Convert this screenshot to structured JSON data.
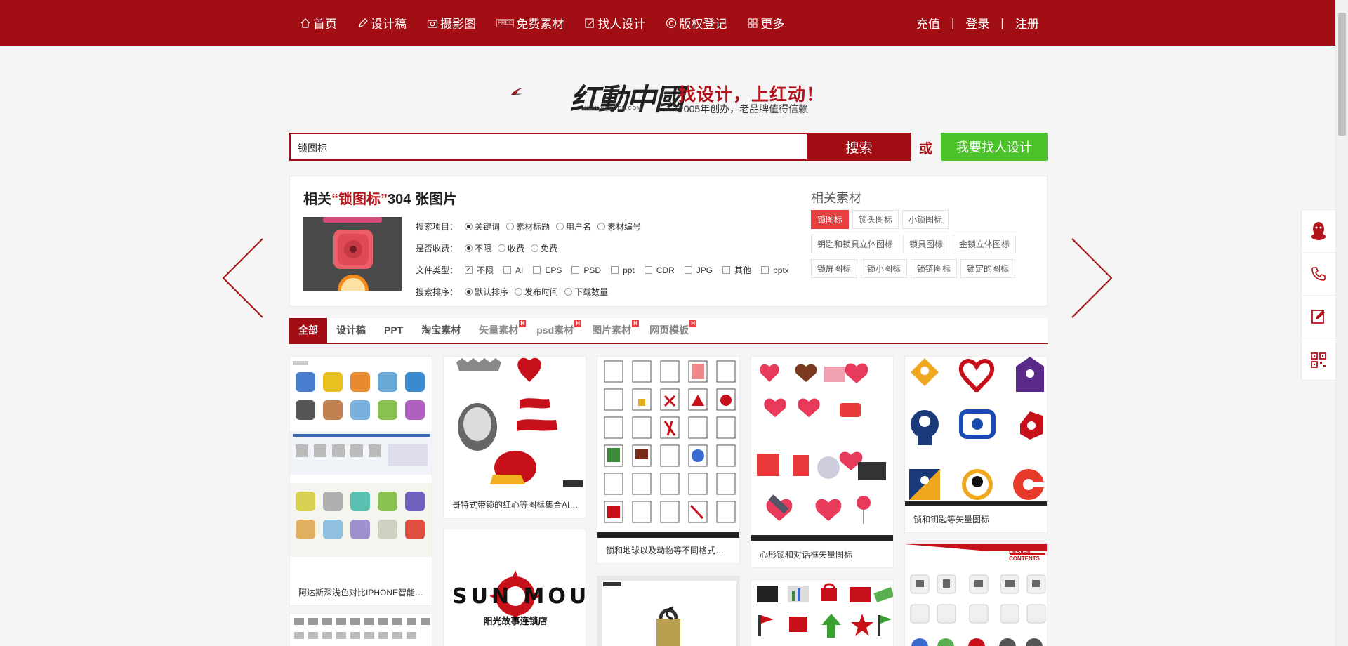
{
  "nav": {
    "items": [
      {
        "label": "首页",
        "icon": "home-icon"
      },
      {
        "label": "设计稿",
        "icon": "pen-icon"
      },
      {
        "label": "摄影图",
        "icon": "camera-icon"
      },
      {
        "label": "免费素材",
        "icon": "free-icon",
        "tag": "FREE"
      },
      {
        "label": "找人设计",
        "icon": "edit-icon"
      },
      {
        "label": "版权登记",
        "icon": "copyright-icon"
      },
      {
        "label": "更多",
        "icon": "grid-icon"
      }
    ],
    "recharge": "充值",
    "login": "登录",
    "register": "注册",
    "separator": "|"
  },
  "logo": {
    "cn_text": "红動中國",
    "url_text": "WWW.REDOCN.COM",
    "slogan_main": "找设计，上红动！",
    "slogan_sub": "2005年创办，老品牌值得信赖"
  },
  "search": {
    "value": "锁图标",
    "button": "搜索",
    "or": "或",
    "find_designer": "我要找人设计"
  },
  "results": {
    "prefix": "相关",
    "keyword": "“锁图标”",
    "count_text": "304 张图片"
  },
  "filters": {
    "search_scope": {
      "label": "搜索项目：",
      "options": [
        "关键词",
        "素材标题",
        "用户名",
        "素材编号"
      ],
      "selected": 0
    },
    "charge": {
      "label": "是否收费：",
      "options": [
        "不限",
        "收费",
        "免费"
      ],
      "selected": 0
    },
    "file_type": {
      "label": "文件类型：",
      "options": [
        "不限",
        "AI",
        "EPS",
        "PSD",
        "ppt",
        "CDR",
        "JPG",
        "其他",
        "pptx"
      ],
      "selected": 0
    },
    "sort": {
      "label": "搜索排序：",
      "options": [
        "默认排序",
        "发布时间",
        "下载数量"
      ],
      "selected": 0
    }
  },
  "related": {
    "title": "相关素材",
    "tags": [
      "锁图标",
      "锁头图标",
      "小锁图标",
      "钥匙和锁具立体图标",
      "锁具图标",
      "金锁立体图标",
      "锁屏图标",
      "锁小图标",
      "锁链图标",
      "锁定的图标"
    ],
    "active": 0
  },
  "tabs": [
    {
      "label": "全部",
      "active": true,
      "hot": false
    },
    {
      "label": "设计稿",
      "active": false,
      "hot": false
    },
    {
      "label": "PPT",
      "active": false,
      "hot": false
    },
    {
      "label": "淘宝素材",
      "active": false,
      "hot": false
    },
    {
      "label": "矢量素材",
      "active": false,
      "hot": true
    },
    {
      "label": "psd素材",
      "active": false,
      "hot": true
    },
    {
      "label": "图片素材",
      "active": false,
      "hot": true
    },
    {
      "label": "网页模板",
      "active": false,
      "hot": true
    }
  ],
  "hot_badge": "H",
  "cards": [
    {
      "caption": "阿达斯深浅色对比IPHONE智能手机图标"
    },
    {
      "caption": "哥特式带锁的红心等图标集合AI矢量素材"
    },
    {
      "caption": "锁和地球以及动物等不同格式文件图标"
    },
    {
      "caption": "心形锁和对话框矢量图标"
    },
    {
      "caption": "锁和钥匙等矢量图标"
    },
    {
      "caption": "SUN MOUNT",
      "sub": "阳光故事连锁店"
    },
    {
      "caption": "DESIGN CONTENTS"
    }
  ],
  "colors": {
    "brand": "#a10f14",
    "accent_red": "#e84040",
    "green": "#4cc32a"
  },
  "sidebar": [
    "qq-icon",
    "phone-icon",
    "edit-icon",
    "qrcode-icon"
  ]
}
